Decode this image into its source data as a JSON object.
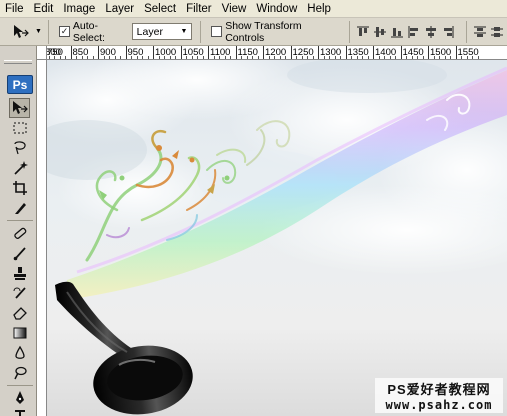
{
  "menubar": {
    "items": [
      "File",
      "Edit",
      "Image",
      "Layer",
      "Select",
      "Filter",
      "View",
      "Window",
      "Help"
    ]
  },
  "options": {
    "tool": "move-tool-icon",
    "auto_select_label": "Auto-Select:",
    "auto_select_checked": true,
    "auto_select_value": "Layer",
    "transform_label": "Show Transform Controls",
    "transform_checked": false
  },
  "ruler": {
    "corner": "750",
    "labels": [
      "800",
      "850",
      "900",
      "950",
      "1000",
      "1050",
      "1100",
      "1150",
      "1200",
      "1250",
      "1300",
      "1350",
      "1400",
      "1450",
      "1500",
      "1550"
    ]
  },
  "toolbox": {
    "logo": "Ps",
    "tools": [
      "move-tool-icon",
      "marquee-tool-icon",
      "lasso-tool-icon",
      "magic-wand-tool-icon",
      "crop-tool-icon",
      "slice-tool-icon",
      "healing-brush-tool-icon",
      "brush-tool-icon",
      "clone-stamp-tool-icon",
      "history-brush-tool-icon",
      "eraser-tool-icon",
      "gradient-tool-icon",
      "blur-tool-icon",
      "dodge-tool-icon",
      "pen-tool-icon",
      "type-tool-icon"
    ]
  },
  "watermark": {
    "line1": "PS爱好者教程网",
    "line2": "www.psahz.com"
  },
  "colors": {
    "accent": "#2e6fc0",
    "chrome": "#d4d0c8",
    "glass": "#0a0a0a"
  }
}
